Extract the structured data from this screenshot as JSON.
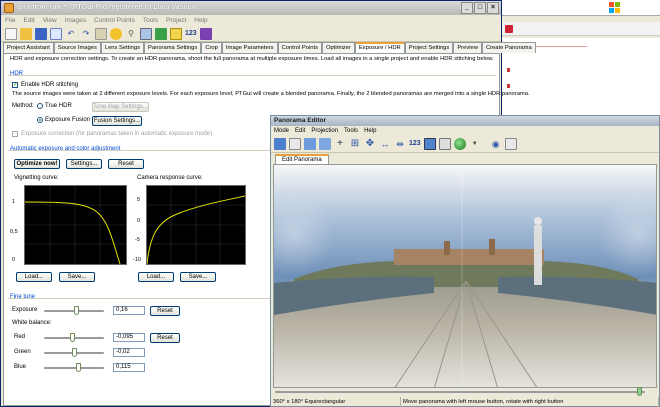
{
  "main_window": {
    "title": "pra-from raw * - PTGui Pro registered to Luca Vascon",
    "menu": [
      "File",
      "Edit",
      "View",
      "Images",
      "Control Points",
      "Tools",
      "Project",
      "Help"
    ],
    "toolbar_text_icon": "123",
    "tabs": [
      "Project Assistant",
      "Source Images",
      "Lens Settings",
      "Panorama Settings",
      "Crop",
      "Image Parameters",
      "Control Points",
      "Optimizer",
      "Exposure / HDR",
      "Project Settings",
      "Preview",
      "Create Panorama"
    ],
    "active_tab": "Exposure / HDR",
    "description": "HDR and exposure correction settings. To create an HDR panorama, shoot the full panorama at multiple exposure times. Load all images in a single project and enable HDR stitching below.",
    "hdr": {
      "group_title": "HDR",
      "enable_label": "Enable HDR stitching",
      "info": "The source images were taken at 2 different exposure levels. For each exposure level, PTGui will create a blended panorama. Finally, the 2 blended panoramas are merged into a single HDR panorama.",
      "method_label": "Method:",
      "true_hdr_label": "True HDR",
      "tone_map_button": "Tone Map Settings...",
      "exposure_fusion_label": "Exposure Fusion",
      "fusion_settings_button": "Fusion Settings...",
      "exposure_correction_label": "Exposure correction (for panoramas taken in automatic exposure mode)"
    },
    "auto": {
      "group_title": "Automatic exposure and color adjustment",
      "optimize_button": "Optimize now!",
      "settings_button": "Settings...",
      "reset_button": "Reset",
      "vignetting_label": "Vignetting curve:",
      "vignetting_ticks": [
        "1",
        "0,5",
        "0"
      ],
      "camera_label": "Camera response curve:",
      "camera_ticks": [
        "5",
        "0",
        "-5",
        "-10"
      ],
      "load_button": "Load...",
      "save_button": "Save..."
    },
    "fine_tune": {
      "group_title": "Fine tune",
      "exposure_label": "Exposure",
      "exposure_value": "0,16",
      "white_balance_label": "White balance:",
      "red_label": "Red",
      "red_value": "-0,095",
      "green_label": "Green",
      "green_value": "-0,02",
      "blue_label": "Blue",
      "blue_value": "0,115",
      "reset_button": "Reset"
    }
  },
  "panorama_editor": {
    "title": "Panorama Editor",
    "menu": [
      "Mode",
      "Edit",
      "Projection",
      "Tools",
      "Help"
    ],
    "toolbar_text_icon": "123",
    "tab": "Edit Panorama",
    "status_projection": "360° x 180° Equirectangular",
    "status_hint": "Move panorama with left mouse button, rotate with right button"
  },
  "colors": {
    "accent_blue": "#0046d5",
    "tab_highlight": "#e6a23c",
    "curve_yellow": "#e6e600"
  }
}
